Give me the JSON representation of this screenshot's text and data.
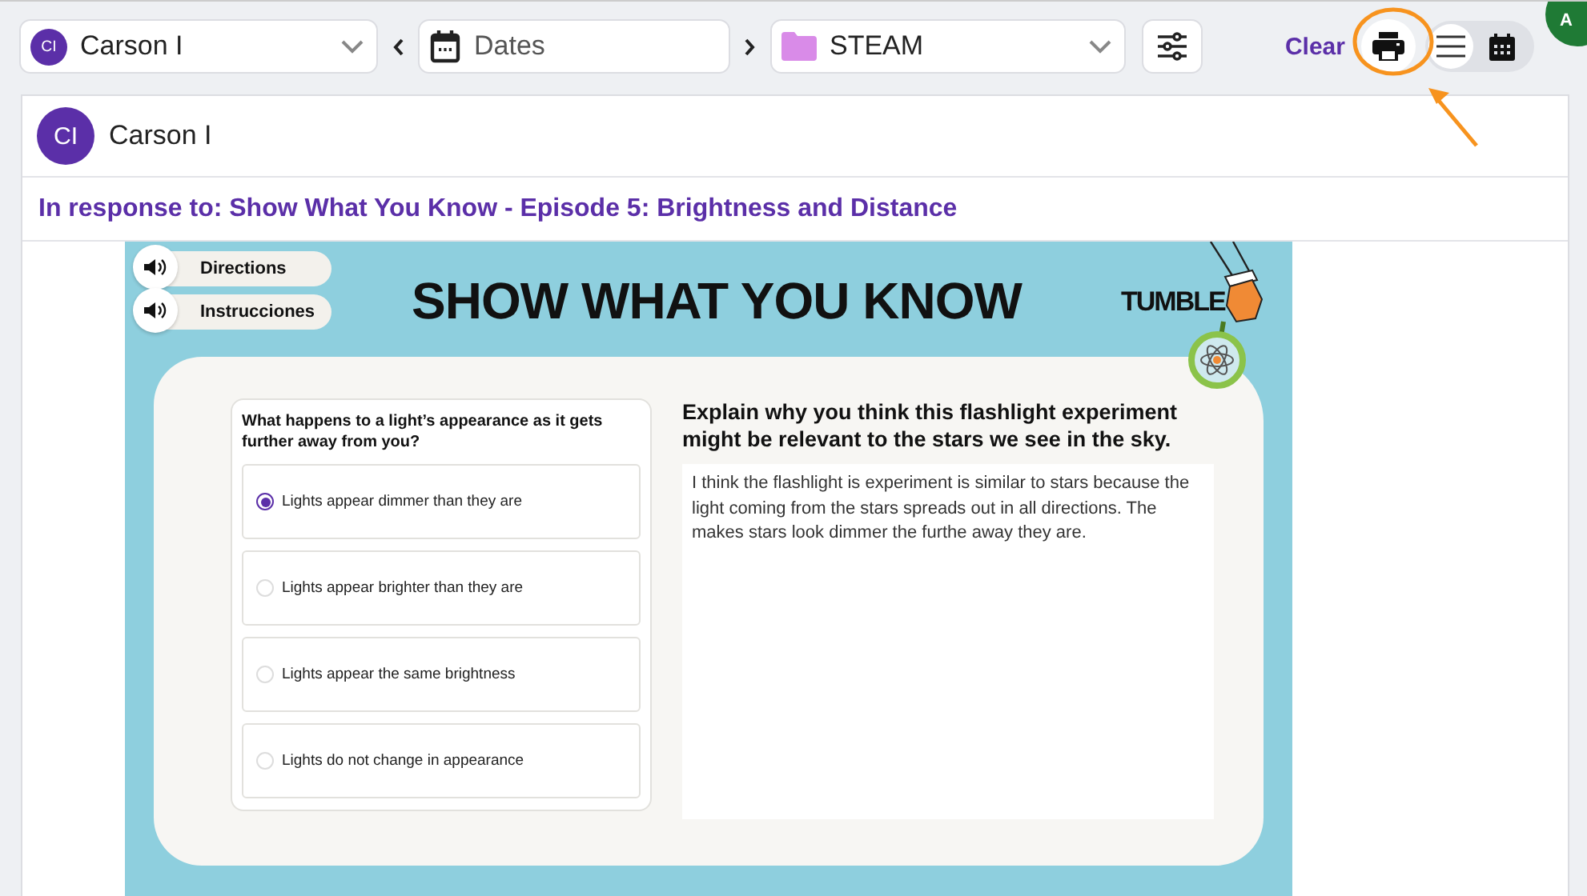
{
  "toolbar": {
    "student": {
      "initials": "CI",
      "name": "Carson I"
    },
    "dates": {
      "placeholder": "Dates"
    },
    "subject": "STEAM",
    "clear": "Clear",
    "view_toggle": [
      {
        "kind": "list",
        "selected": true
      },
      {
        "kind": "calendar",
        "selected": false
      }
    ],
    "account_initial": "A"
  },
  "response": {
    "initials": "CI",
    "name": "Carson I",
    "in_response_to": "In response to: Show What You Know - Episode 5: Brightness and Distance"
  },
  "slide": {
    "audio_buttons": [
      "Directions",
      "Instrucciones"
    ],
    "title": "SHOW WHAT YOU KNOW",
    "brand": "TUMBLE",
    "question": {
      "prompt": "What happens to a light’s appearance as it gets further away from you?",
      "options": [
        {
          "label": "Lights appear dimmer than they are",
          "selected": true
        },
        {
          "label": "Lights appear brighter than they are",
          "selected": false
        },
        {
          "label": "Lights appear the same brightness",
          "selected": false
        },
        {
          "label": "Lights do not change in appearance",
          "selected": false
        }
      ]
    },
    "written": {
      "prompt": "Explain why you think this flashlight experiment might be relevant to the stars we see in the sky.",
      "answer": "I think the flashlight is experiment is similar to stars because the light coming from the stars spreads out in all directions. The makes stars look dimmer the furthe away they are."
    }
  }
}
